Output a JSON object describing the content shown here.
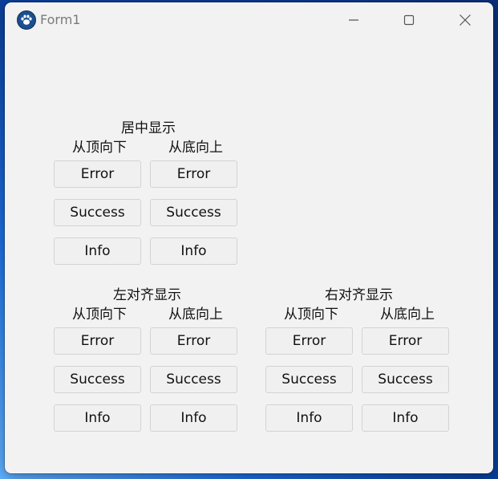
{
  "window": {
    "title": "Form1"
  },
  "groups": {
    "center": {
      "title": "居中显示",
      "top_down": {
        "label": "从顶向下",
        "buttons": [
          "Error",
          "Success",
          "Info"
        ]
      },
      "bottom_up": {
        "label": "从底向上",
        "buttons": [
          "Error",
          "Success",
          "Info"
        ]
      }
    },
    "left": {
      "title": "左对齐显示",
      "top_down": {
        "label": "从顶向下",
        "buttons": [
          "Error",
          "Success",
          "Info"
        ]
      },
      "bottom_up": {
        "label": "从底向上",
        "buttons": [
          "Error",
          "Success",
          "Info"
        ]
      }
    },
    "right": {
      "title": "右对齐显示",
      "top_down": {
        "label": "从顶向下",
        "buttons": [
          "Error",
          "Success",
          "Info"
        ]
      },
      "bottom_up": {
        "label": "从底向上",
        "buttons": [
          "Error",
          "Success",
          "Info"
        ]
      }
    }
  }
}
